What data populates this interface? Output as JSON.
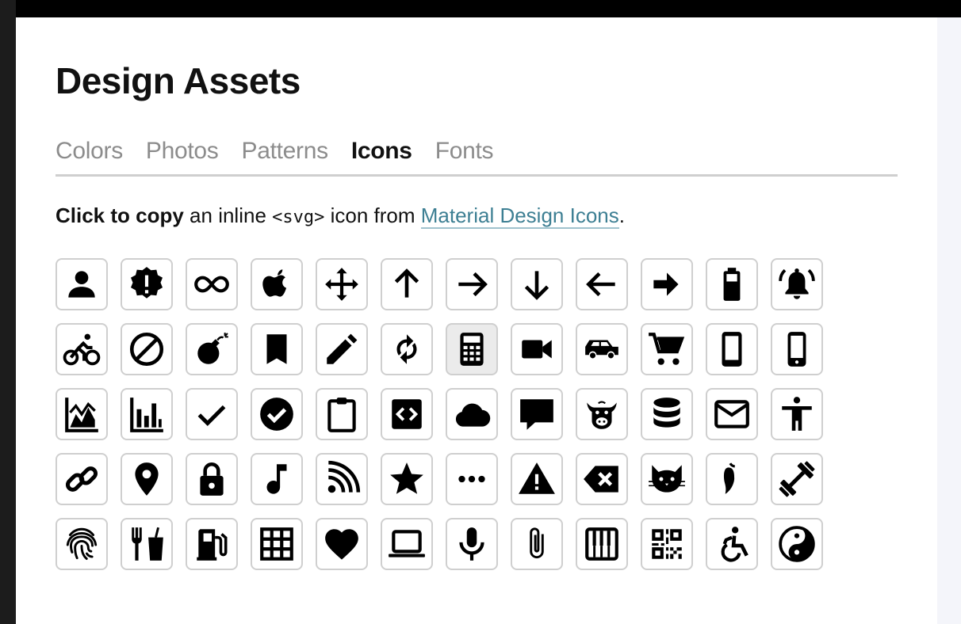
{
  "modal": {
    "title": "Design Assets",
    "tabs": [
      {
        "label": "Colors",
        "active": false
      },
      {
        "label": "Photos",
        "active": false
      },
      {
        "label": "Patterns",
        "active": false
      },
      {
        "label": "Icons",
        "active": true
      },
      {
        "label": "Fonts",
        "active": false
      }
    ],
    "instructions": {
      "bold": "Click to copy",
      "text_before_code": " an inline ",
      "code": "<svg>",
      "text_after_code": " icon from ",
      "link": "Material Design Icons",
      "end": "."
    }
  },
  "icons": [
    "account",
    "alert-decagram",
    "infinity",
    "apple",
    "arrow-all",
    "arrow-up",
    "arrow-right",
    "arrow-down",
    "arrow-left",
    "arrow-right-bold",
    "battery",
    "bell-ring",
    "bike",
    "cancel",
    "bomb",
    "bookmark",
    "pencil",
    "autorenew",
    "calculator",
    "video",
    "car",
    "cart",
    "cellphone",
    "cellphone-iphone",
    "chart-areaspline",
    "chart-bar",
    "check",
    "check-circle",
    "clipboard",
    "code-braces-box",
    "cloud",
    "comment",
    "cow",
    "database",
    "email",
    "human",
    "link",
    "map-marker",
    "lock",
    "music-note",
    "rss",
    "star",
    "dots-horizontal",
    "alert",
    "backspace",
    "cat",
    "chili",
    "dumbbell",
    "fingerprint",
    "food",
    "gas-station",
    "grid",
    "heart",
    "laptop",
    "microphone",
    "paperclip",
    "piano",
    "qrcode",
    "wheelchair",
    "yin-yang"
  ],
  "hovered_icon": "calculator"
}
